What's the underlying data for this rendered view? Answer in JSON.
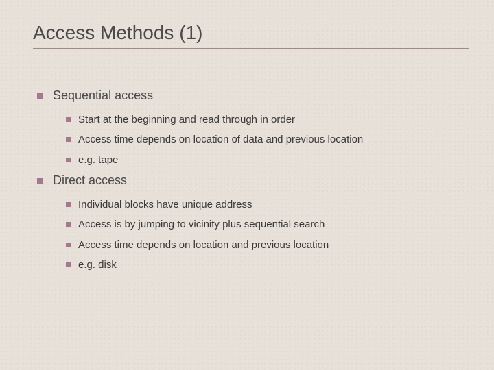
{
  "title": "Access Methods (1)",
  "sections": [
    {
      "label": "Sequential access",
      "items": [
        "Start at the beginning and read through in order",
        "Access time depends on location of data and previous location",
        "e.g. tape"
      ]
    },
    {
      "label": "Direct access",
      "items": [
        "Individual blocks have unique address",
        "Access is by jumping to vicinity plus sequential search",
        "Access time depends on location and previous location",
        "e.g. disk"
      ]
    }
  ]
}
